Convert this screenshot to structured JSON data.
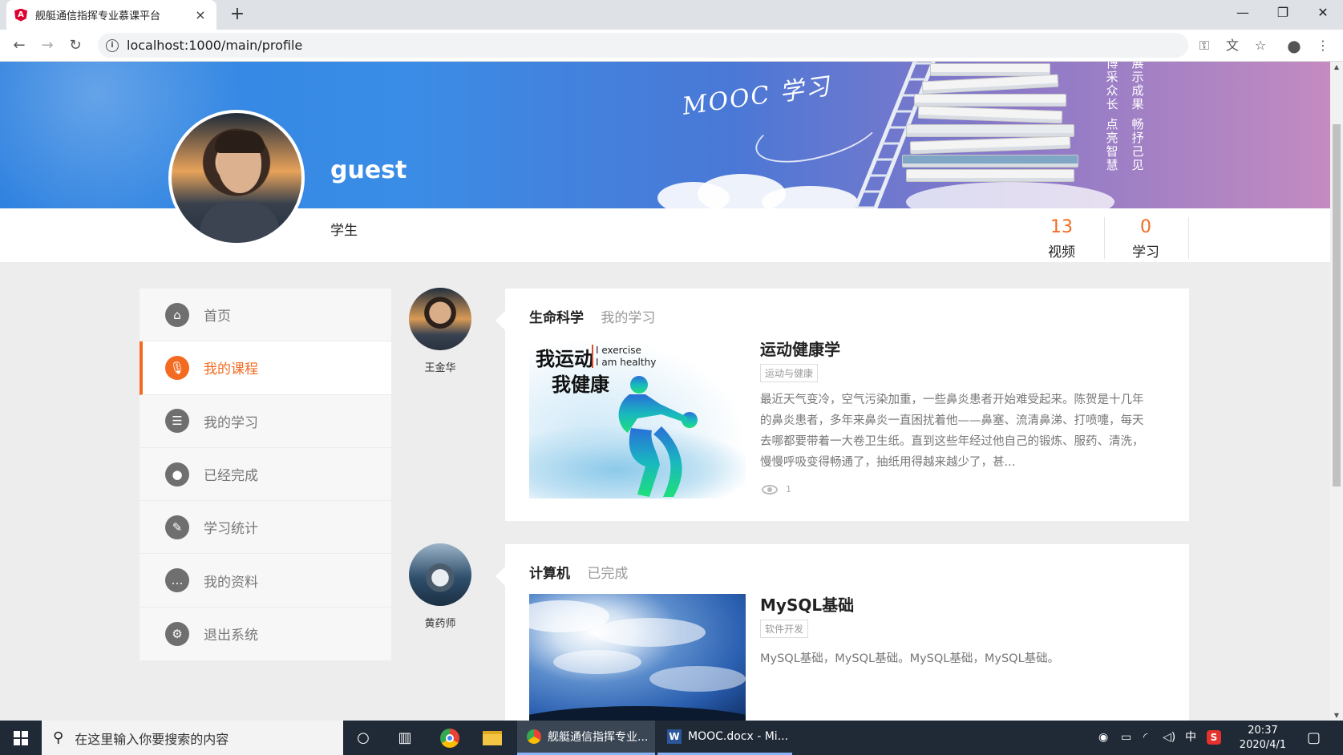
{
  "browser": {
    "tab_title": "舰艇通信指挥专业慕课平台",
    "tab_close": "×",
    "new_tab": "+",
    "url": "localhost:1000/main/profile",
    "window_controls": [
      "—",
      "❐",
      "✕"
    ]
  },
  "profile": {
    "username": "guest",
    "role": "学生",
    "stats": [
      {
        "value": "13",
        "label": "视频"
      },
      {
        "value": "0",
        "label": "学习"
      }
    ]
  },
  "banner": {
    "logo_text": "MOOC 学习",
    "slogans": [
      "博采众长",
      "点亮智慧",
      "展示成果",
      "畅抒己见"
    ]
  },
  "sidebar": {
    "items": [
      {
        "label": "首页",
        "icon": "home-icon",
        "glyph": "⌂",
        "active": false
      },
      {
        "label": "我的课程",
        "icon": "microphone-icon",
        "glyph": "🎙",
        "active": true
      },
      {
        "label": "我的学习",
        "icon": "list-icon",
        "glyph": "☰",
        "active": false
      },
      {
        "label": "已经完成",
        "icon": "user-icon",
        "glyph": "●",
        "active": false
      },
      {
        "label": "学习统计",
        "icon": "pen-icon",
        "glyph": "✎",
        "active": false
      },
      {
        "label": "我的资料",
        "icon": "chat-icon",
        "glyph": "…",
        "active": false
      },
      {
        "label": "退出系统",
        "icon": "gear-icon",
        "glyph": "⚙",
        "active": false
      }
    ]
  },
  "feed": [
    {
      "author": "王金华",
      "category": "生命科学",
      "subtitle": "我的学习",
      "course_title": "运动健康学",
      "tag": "运动与健康",
      "thumb_text": [
        "我运动",
        "我健康",
        "I exercise",
        "I am healthy"
      ],
      "description": "最近天气变冷，空气污染加重，一些鼻炎患者开始难受起来。陈贺是十几年的鼻炎患者，多年来鼻炎一直困扰着他——鼻塞、流清鼻涕、打喷嚏，每天去哪都要带着一大卷卫生纸。直到这些年经过他自己的锻炼、服药、清洗，慢慢呼吸变得畅通了，抽纸用得越来越少了，甚...",
      "views": "1"
    },
    {
      "author": "黄药师",
      "category": "计算机",
      "subtitle": "已完成",
      "course_title": "MySQL基础",
      "tag": "软件开发",
      "description": "MySQL基础，MySQL基础。MySQL基础，MySQL基础。"
    }
  ],
  "taskbar": {
    "search_placeholder": "在这里输入你要搜索的内容",
    "apps": [
      {
        "label": "舰艇通信指挥专业..."
      },
      {
        "label": "MOOC.docx - Mi..."
      }
    ],
    "ime": "中",
    "time": "20:37",
    "date": "2020/4/1"
  },
  "colors": {
    "accent": "#f36b21",
    "banner_start": "#2f82e0",
    "banner_end": "#c48bc0"
  }
}
